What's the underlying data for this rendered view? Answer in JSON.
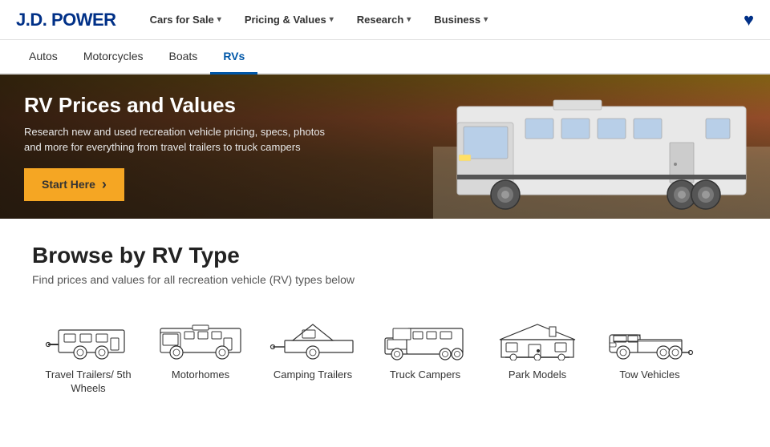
{
  "header": {
    "logo": "J.D. POWER",
    "nav": [
      {
        "label": "Cars for Sale",
        "has_arrow": true
      },
      {
        "label": "Pricing & Values",
        "has_arrow": true
      },
      {
        "label": "Research",
        "has_arrow": true
      },
      {
        "label": "Business",
        "has_arrow": true
      }
    ]
  },
  "subnav": {
    "items": [
      {
        "label": "Autos",
        "active": false
      },
      {
        "label": "Motorcycles",
        "active": false
      },
      {
        "label": "Boats",
        "active": false
      },
      {
        "label": "RVs",
        "active": true
      }
    ]
  },
  "hero": {
    "title": "RV Prices and Values",
    "description": "Research new and used recreation vehicle pricing, specs, photos and more for everything from travel trailers to truck campers",
    "button_label": "Start Here",
    "button_arrow": "›"
  },
  "browse": {
    "title": "Browse by RV Type",
    "subtitle": "Find prices and values for all recreation vehicle (RV) types below",
    "items": [
      {
        "label": "Travel Trailers/ 5th Wheels",
        "icon": "travel-trailer"
      },
      {
        "label": "Motorhomes",
        "icon": "motorhome"
      },
      {
        "label": "Camping Trailers",
        "icon": "camping-trailer"
      },
      {
        "label": "Truck Campers",
        "icon": "truck-camper"
      },
      {
        "label": "Park Models",
        "icon": "park-model"
      },
      {
        "label": "Tow Vehicles",
        "icon": "tow-vehicle"
      }
    ]
  }
}
